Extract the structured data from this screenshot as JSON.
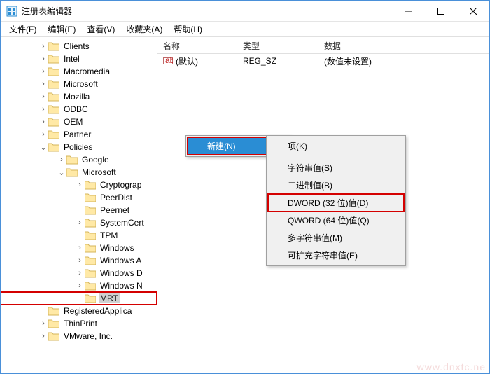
{
  "window": {
    "title": "注册表编辑器"
  },
  "menu": {
    "file": "文件(F)",
    "edit": "编辑(E)",
    "view": "查看(V)",
    "favorites": "收藏夹(A)",
    "help": "帮助(H)"
  },
  "tree": {
    "clients": "Clients",
    "intel": "Intel",
    "macromedia": "Macromedia",
    "microsoft": "Microsoft",
    "mozilla": "Mozilla",
    "odbc": "ODBC",
    "oem": "OEM",
    "partner": "Partner",
    "policies": "Policies",
    "google": "Google",
    "ms": "Microsoft",
    "cryptograp": "Cryptograp",
    "peerdist": "PeerDist",
    "peernet": "Peernet",
    "systemcert": "SystemCert",
    "tpm": "TPM",
    "windows": "Windows",
    "windowsa": "Windows A",
    "windowsd": "Windows D",
    "windowsn": "Windows N",
    "mrt": "MRT",
    "registeredapplica": "RegisteredApplica",
    "thinprint": "ThinPrint",
    "vmware": "VMware, Inc."
  },
  "list": {
    "cols": {
      "name": "名称",
      "type": "类型",
      "data": "数据"
    },
    "row0": {
      "name": "(默认)",
      "type": "REG_SZ",
      "data": "(数值未设置)"
    }
  },
  "ctx1": {
    "new": "新建(N)"
  },
  "ctx2": {
    "key": "项(K)",
    "string": "字符串值(S)",
    "binary": "二进制值(B)",
    "dword": "DWORD (32 位)值(D)",
    "qword": "QWORD (64 位)值(Q)",
    "multi": "多字符串值(M)",
    "expand": "可扩充字符串值(E)"
  },
  "watermark": "www.dnxtc.ne"
}
